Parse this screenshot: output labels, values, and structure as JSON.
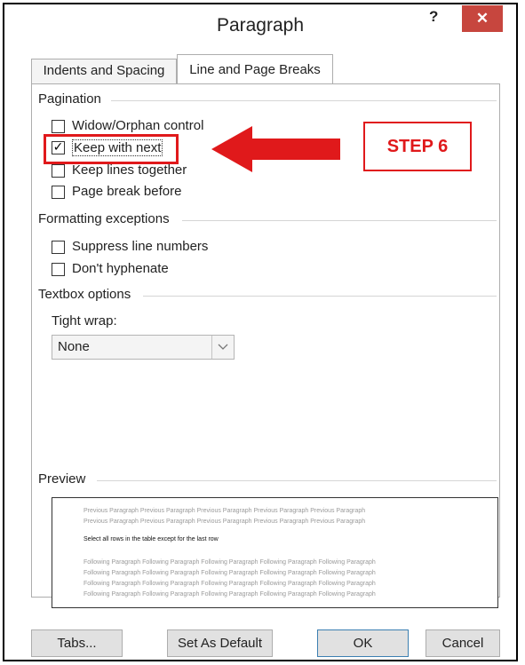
{
  "window": {
    "title": "Paragraph",
    "help_label": "?",
    "close_label": "✕"
  },
  "tabs": [
    {
      "label": "Indents and Spacing",
      "active": false
    },
    {
      "label": "Line and Page Breaks",
      "active": true
    }
  ],
  "pagination": {
    "heading": "Pagination",
    "options": [
      {
        "label": "Widow/Orphan control",
        "checked": false
      },
      {
        "label": "Keep with next",
        "checked": true
      },
      {
        "label": "Keep lines together",
        "checked": false
      },
      {
        "label": "Page break before",
        "checked": false
      }
    ]
  },
  "formatting_exceptions": {
    "heading": "Formatting exceptions",
    "options": [
      {
        "label": "Suppress line numbers",
        "checked": false
      },
      {
        "label": "Don't hyphenate",
        "checked": false
      }
    ]
  },
  "textbox_options": {
    "heading": "Textbox options",
    "tight_wrap_label": "Tight wrap:",
    "tight_wrap_value": "None"
  },
  "annotation": {
    "step_label": "STEP 6",
    "color": "#e0191b"
  },
  "preview": {
    "heading": "Preview",
    "previous_lines": [
      "Previous Paragraph Previous Paragraph Previous Paragraph Previous Paragraph Previous Paragraph",
      "Previous Paragraph Previous Paragraph Previous Paragraph Previous Paragraph Previous Paragraph"
    ],
    "selected_text": "Select all rows in the table except for the last row",
    "following_lines": [
      "Following Paragraph Following Paragraph Following Paragraph Following Paragraph Following Paragraph",
      "Following Paragraph Following Paragraph Following Paragraph Following Paragraph Following Paragraph",
      "Following Paragraph Following Paragraph Following Paragraph Following Paragraph Following Paragraph",
      "Following Paragraph Following Paragraph Following Paragraph Following Paragraph Following Paragraph"
    ]
  },
  "buttons": {
    "tabs": "Tabs...",
    "set_default": "Set As Default",
    "ok": "OK",
    "cancel": "Cancel"
  }
}
